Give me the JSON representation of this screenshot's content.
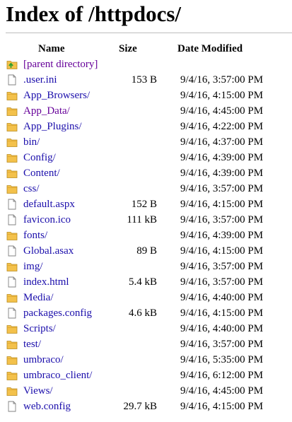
{
  "page": {
    "title": "Index of /httpdocs/"
  },
  "columns": {
    "name": "Name",
    "size": "Size",
    "date": "Date Modified"
  },
  "rows": [
    {
      "icon": "parent-folder-icon",
      "name": "[parent directory]",
      "size": "",
      "date": "",
      "visited": true
    },
    {
      "icon": "file-icon",
      "name": ".user.ini",
      "size": "153 B",
      "date": "9/4/16, 3:57:00 PM",
      "visited": false
    },
    {
      "icon": "folder-icon",
      "name": "App_Browsers/",
      "size": "",
      "date": "9/4/16, 4:15:00 PM",
      "visited": false
    },
    {
      "icon": "folder-icon",
      "name": "App_Data/",
      "size": "",
      "date": "9/4/16, 4:45:00 PM",
      "visited": true
    },
    {
      "icon": "folder-icon",
      "name": "App_Plugins/",
      "size": "",
      "date": "9/4/16, 4:22:00 PM",
      "visited": false
    },
    {
      "icon": "folder-icon",
      "name": "bin/",
      "size": "",
      "date": "9/4/16, 4:37:00 PM",
      "visited": false
    },
    {
      "icon": "folder-icon",
      "name": "Config/",
      "size": "",
      "date": "9/4/16, 4:39:00 PM",
      "visited": false
    },
    {
      "icon": "folder-icon",
      "name": "Content/",
      "size": "",
      "date": "9/4/16, 4:39:00 PM",
      "visited": false
    },
    {
      "icon": "folder-icon",
      "name": "css/",
      "size": "",
      "date": "9/4/16, 3:57:00 PM",
      "visited": false
    },
    {
      "icon": "file-icon",
      "name": "default.aspx",
      "size": "152 B",
      "date": "9/4/16, 4:15:00 PM",
      "visited": false
    },
    {
      "icon": "file-icon",
      "name": "favicon.ico",
      "size": "111 kB",
      "date": "9/4/16, 3:57:00 PM",
      "visited": false
    },
    {
      "icon": "folder-icon",
      "name": "fonts/",
      "size": "",
      "date": "9/4/16, 4:39:00 PM",
      "visited": false
    },
    {
      "icon": "file-icon",
      "name": "Global.asax",
      "size": "89 B",
      "date": "9/4/16, 4:15:00 PM",
      "visited": false
    },
    {
      "icon": "folder-icon",
      "name": "img/",
      "size": "",
      "date": "9/4/16, 3:57:00 PM",
      "visited": false
    },
    {
      "icon": "file-icon",
      "name": "index.html",
      "size": "5.4 kB",
      "date": "9/4/16, 3:57:00 PM",
      "visited": false
    },
    {
      "icon": "folder-icon",
      "name": "Media/",
      "size": "",
      "date": "9/4/16, 4:40:00 PM",
      "visited": false
    },
    {
      "icon": "file-icon",
      "name": "packages.config",
      "size": "4.6 kB",
      "date": "9/4/16, 4:15:00 PM",
      "visited": false
    },
    {
      "icon": "folder-icon",
      "name": "Scripts/",
      "size": "",
      "date": "9/4/16, 4:40:00 PM",
      "visited": false
    },
    {
      "icon": "folder-icon",
      "name": "test/",
      "size": "",
      "date": "9/4/16, 3:57:00 PM",
      "visited": false
    },
    {
      "icon": "folder-icon",
      "name": "umbraco/",
      "size": "",
      "date": "9/4/16, 5:35:00 PM",
      "visited": false
    },
    {
      "icon": "folder-icon",
      "name": "umbraco_client/",
      "size": "",
      "date": "9/4/16, 6:12:00 PM",
      "visited": false
    },
    {
      "icon": "folder-icon",
      "name": "Views/",
      "size": "",
      "date": "9/4/16, 4:45:00 PM",
      "visited": false
    },
    {
      "icon": "file-icon",
      "name": "web.config",
      "size": "29.7 kB",
      "date": "9/4/16, 4:15:00 PM",
      "visited": false
    }
  ],
  "colors": {
    "link": "#1a0dab",
    "visited": "#660099",
    "folder": "#f3c14b",
    "parent_arrow": "#2e9e2e"
  }
}
